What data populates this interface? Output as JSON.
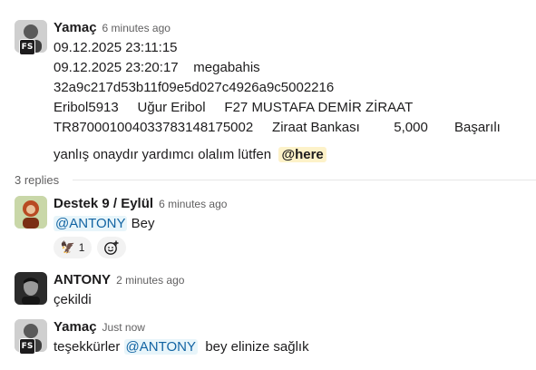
{
  "messages": [
    {
      "author": "Yamaç",
      "time": "6 minutes ago",
      "badge": "FS",
      "lines": [
        "09.12.2025 23:11:15",
        "09.12.2025 23:20:17    megabahis",
        "32a9c217d53b11f09e5d027c4926a9c5002216",
        "Eribol5913     Uğur Eribol     F27 MUSTAFA DEMİR ZİRAAT",
        "TR870001004033783148175002     Ziraat Bankası         5,000       Başarılı"
      ],
      "last_line_text": "yanlış onaydır yardımcı olalım lütfen",
      "mention": "@here"
    }
  ],
  "thread": {
    "replies_label": "3 replies",
    "replies": [
      {
        "author": "Destek 9 / Eylül",
        "time": "6 minutes ago",
        "mention": "@ANTONY",
        "text_after": " Bey",
        "reaction_emoji": "🦅",
        "reaction_count": "1",
        "add_reaction_icon": "emoji-add-icon"
      },
      {
        "author": "ANTONY",
        "time": "2 minutes ago",
        "text": "çekildi"
      },
      {
        "author": "Yamaç",
        "time": "Just now",
        "badge": "FS",
        "text_before": "teşekkürler ",
        "mention": "@ANTONY",
        "text_after": "  bey elinize sağlık"
      }
    ]
  },
  "colors": {
    "mention_here_bg": "#fdf2c9",
    "mention_user_bg": "#e8f5fa",
    "mention_user_fg": "#1264a3"
  }
}
